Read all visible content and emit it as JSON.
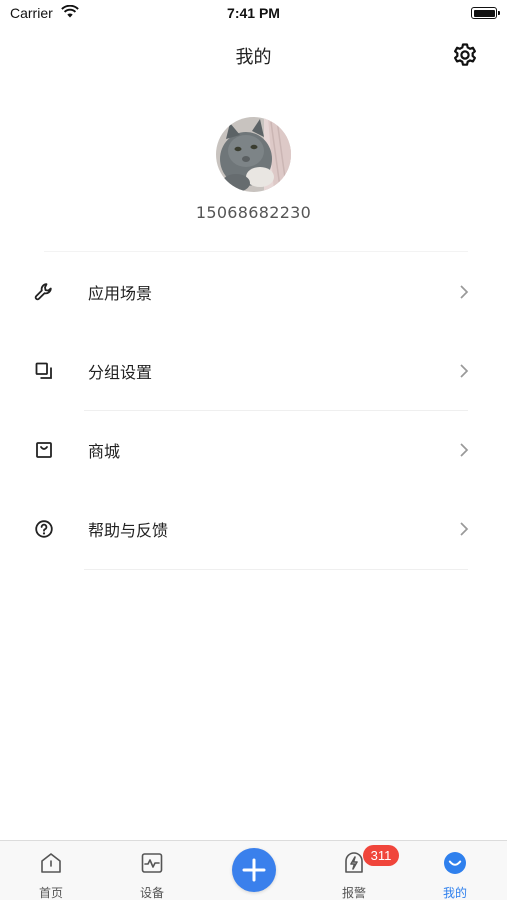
{
  "status_bar": {
    "carrier": "Carrier",
    "time": "7:41 PM"
  },
  "header": {
    "title": "我的",
    "settings_icon": "gear-icon"
  },
  "profile": {
    "phone": "15068682230",
    "avatar_icon": "avatar-cat"
  },
  "menu": [
    {
      "label": "应用场景",
      "icon": "wrench-icon"
    },
    {
      "label": "分组设置",
      "icon": "group-icon"
    },
    {
      "label": "商城",
      "icon": "shop-bag-icon"
    },
    {
      "label": "帮助与反馈",
      "icon": "help-circle-icon"
    }
  ],
  "tabbar": {
    "tabs": [
      {
        "label": "首页",
        "icon": "home-icon",
        "active": false
      },
      {
        "label": "设备",
        "icon": "pulse-monitor-icon",
        "active": false
      },
      {
        "label": "报警",
        "icon": "alarm-bolt-icon",
        "active": false
      },
      {
        "label": "我的",
        "icon": "smile-icon",
        "active": true
      }
    ],
    "add_icon": "plus-icon",
    "alarm_badge": "311"
  },
  "colors": {
    "accent": "#2f80ed",
    "badge": "#f0453b",
    "add_button": "#3a80ec"
  }
}
